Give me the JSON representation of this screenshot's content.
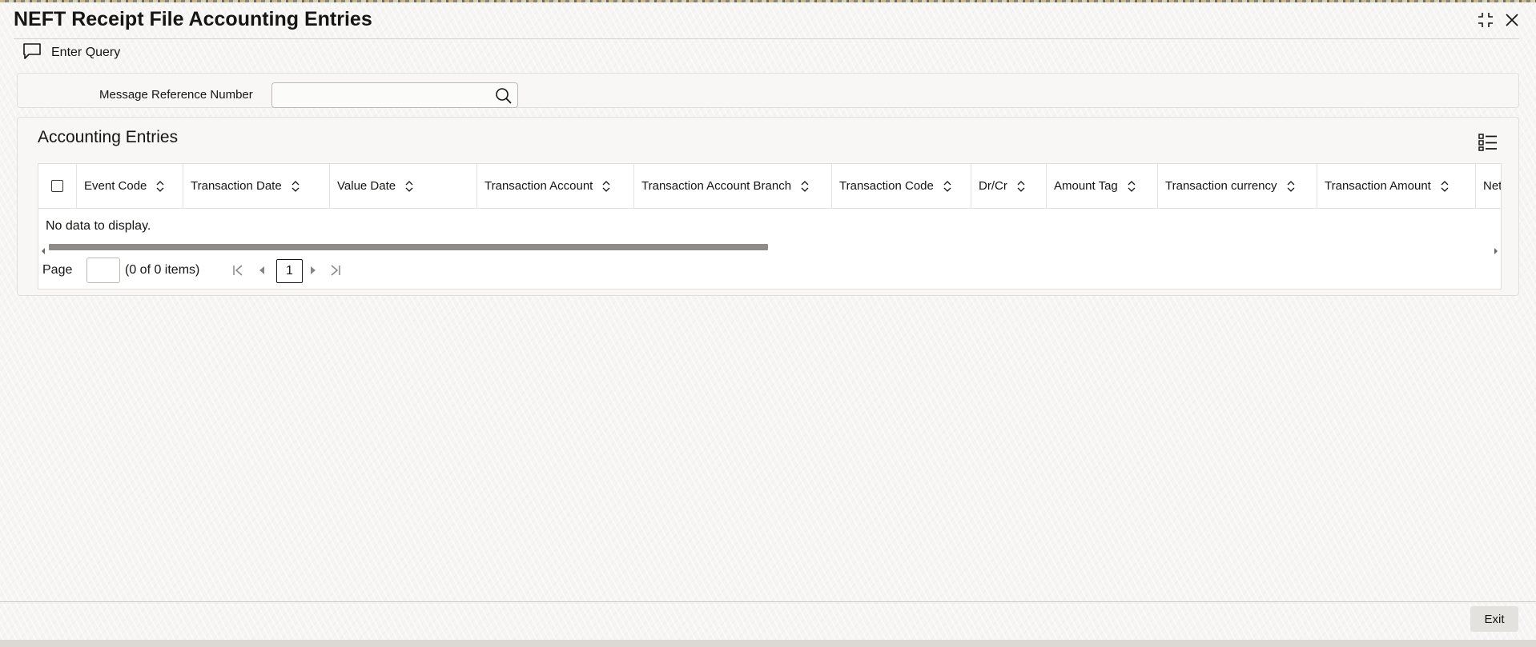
{
  "window": {
    "title": "NEFT Receipt File Accounting Entries",
    "maximize_icon": "collapse-arrows-icon",
    "close_icon": "close-icon"
  },
  "toolbar": {
    "enter_query_label": "Enter Query",
    "enter_query_icon": "chat-bubble-icon"
  },
  "query": {
    "message_reference_label": "Message Reference Number",
    "message_reference_value": "",
    "search_icon": "search-icon"
  },
  "accounting_entries": {
    "title": "Accounting Entries",
    "columns": [
      "Event Code",
      "Transaction Date",
      "Value Date",
      "Transaction Account",
      "Transaction Account Branch",
      "Transaction Code",
      "Dr/Cr",
      "Amount Tag",
      "Transaction currency",
      "Transaction Amount",
      "Net"
    ],
    "rows": [],
    "empty_message": "No data to display.",
    "pagination": {
      "page_label": "Page",
      "page_value": "",
      "items_summary": "(0 of 0 items)",
      "current_page": "1"
    }
  },
  "footer": {
    "exit_label": "Exit"
  },
  "colors": {
    "text": "#161513",
    "panel": "#f8f7f5",
    "border": "#e2dfda",
    "scroll_thumb": "#8f8c88"
  }
}
